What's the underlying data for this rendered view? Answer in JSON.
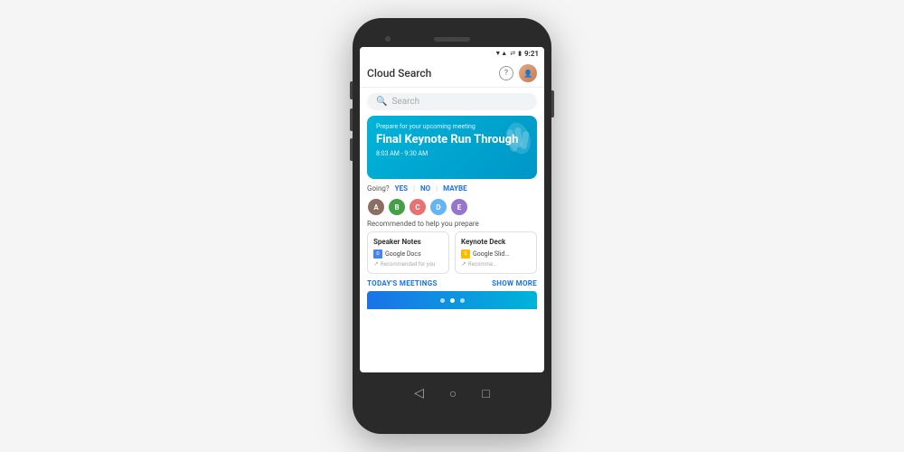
{
  "phone": {
    "status_bar": {
      "time": "9:21",
      "signal": "▼ ▲",
      "wifi": "WiFi",
      "battery": "Battery"
    },
    "header": {
      "title": "Cloud Search",
      "help_label": "?",
      "avatar_initials": "👤"
    },
    "search": {
      "placeholder": "Search"
    },
    "meeting_card": {
      "label": "Prepare for your upcoming meeting",
      "title": "Final Keynote Run Through",
      "time": "8:03 AM - 9:30 AM"
    },
    "rsvp": {
      "label": "Going?",
      "yes": "YES",
      "no": "NO",
      "maybe": "MAYBE"
    },
    "attendees": [
      {
        "color": "#8d6e63",
        "initial": "A"
      },
      {
        "color": "#43a047",
        "initial": "B"
      },
      {
        "color": "#e57373",
        "initial": "C"
      },
      {
        "color": "#64b5f6",
        "initial": "D"
      },
      {
        "color": "#9575cd",
        "initial": "E"
      }
    ],
    "prepare_text": "Recommended to help you prepare",
    "doc_cards": [
      {
        "title": "Speaker Notes",
        "doc_type": "docs",
        "doc_name": "Google Docs",
        "rec_text": "Recommended for you"
      },
      {
        "title": "Keynote Deck",
        "doc_type": "slides",
        "doc_name": "Google Slid...",
        "rec_text": "Recomme..."
      }
    ],
    "bottom_actions": {
      "todays_meetings": "TODAY'S MEETINGS",
      "show_more": "SHOW MORE"
    },
    "nav": {
      "back": "◁",
      "home": "○",
      "recent": "□"
    }
  }
}
